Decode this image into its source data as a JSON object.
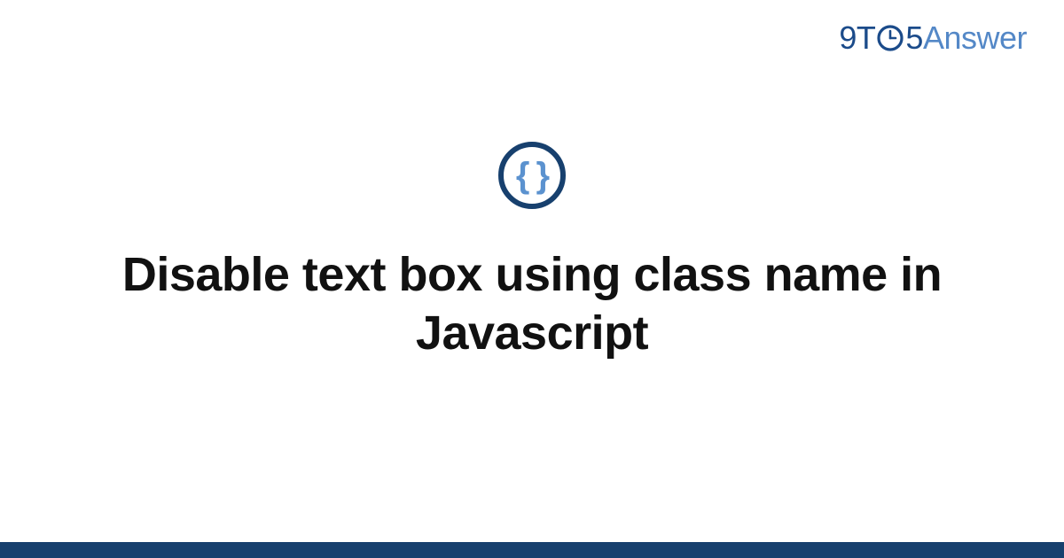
{
  "logo": {
    "part1": "9T",
    "part2": "5",
    "part3": "Answer"
  },
  "main": {
    "icon_label": "code-braces",
    "icon_text": "{ }",
    "title": "Disable text box using class name in Javascript"
  },
  "colors": {
    "dark_blue": "#17406e",
    "mid_blue": "#1b4b8a",
    "light_blue": "#5488c7",
    "brace_blue": "#5b92cf"
  }
}
